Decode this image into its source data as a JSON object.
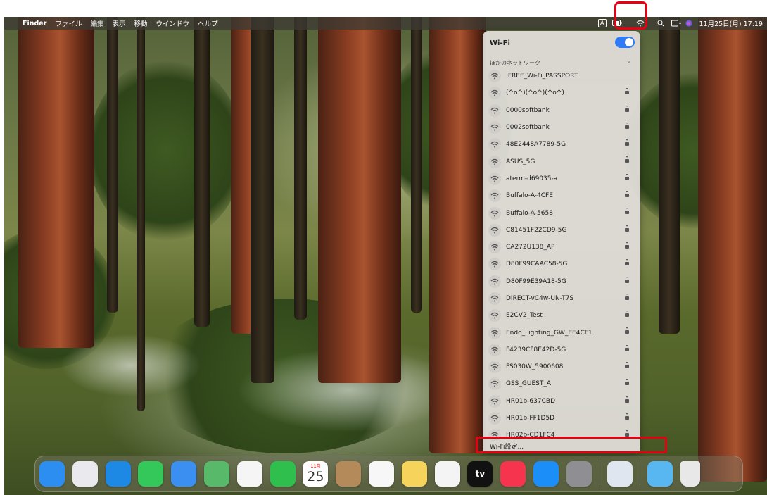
{
  "menubar": {
    "apple_glyph": "",
    "items": [
      "Finder",
      "ファイル",
      "編集",
      "表示",
      "移動",
      "ウインドウ",
      "ヘルプ"
    ],
    "input_indicator": "A",
    "clock": "11月25日(月) 17:19"
  },
  "wifi_menu": {
    "title": "Wi-Fi",
    "toggle_on": true,
    "other_networks_label": "ほかのネットワーク",
    "networks": [
      {
        "name": ".FREE_Wi-Fi_PASSPORT",
        "locked": false
      },
      {
        "name": "(^o^)(^o^)(^o^)",
        "locked": true
      },
      {
        "name": "0000softbank",
        "locked": true
      },
      {
        "name": "0002softbank",
        "locked": true
      },
      {
        "name": "48E2448A7789-5G",
        "locked": true
      },
      {
        "name": "ASUS_5G",
        "locked": true
      },
      {
        "name": "aterm-d69035-a",
        "locked": true
      },
      {
        "name": "Buffalo-A-4CFE",
        "locked": true
      },
      {
        "name": "Buffalo-A-5658",
        "locked": true
      },
      {
        "name": "C81451F22CD9-5G",
        "locked": true
      },
      {
        "name": "CA272U138_AP",
        "locked": true
      },
      {
        "name": "D80F99CAAC58-5G",
        "locked": true
      },
      {
        "name": "D80F99E39A18-5G",
        "locked": true
      },
      {
        "name": "DIRECT-vC4w-UN-T7S",
        "locked": true
      },
      {
        "name": "E2CV2_Test",
        "locked": true
      },
      {
        "name": "Endo_Lighting_GW_EE4CF1",
        "locked": true
      },
      {
        "name": "F4239CF8E42D-5G",
        "locked": true
      },
      {
        "name": "FS030W_5900608",
        "locked": true
      },
      {
        "name": "GSS_GUEST_A",
        "locked": true
      },
      {
        "name": "HR01b-637CBD",
        "locked": true
      },
      {
        "name": "HR01b-FF1D5D",
        "locked": true
      },
      {
        "name": "HR02b-CD1FC4",
        "locked": true
      }
    ],
    "settings_label": "Wi-Fi設定..."
  },
  "dock": {
    "calendar_month": "11月",
    "calendar_day": "25",
    "tv_label": "tv",
    "apps": [
      {
        "name": "finder",
        "color": "#2b8ef0"
      },
      {
        "name": "launchpad",
        "color": "#e9e9ee"
      },
      {
        "name": "safari",
        "color": "#1e88e5"
      },
      {
        "name": "messages",
        "color": "#34c759"
      },
      {
        "name": "mail",
        "color": "#3a8ff0"
      },
      {
        "name": "maps",
        "color": "#59b96a"
      },
      {
        "name": "photos",
        "color": "#f5f5f5"
      },
      {
        "name": "facetime",
        "color": "#2fbf4c"
      },
      {
        "name": "calendar",
        "color": "#ffffff"
      },
      {
        "name": "contacts",
        "color": "#b58a5a"
      },
      {
        "name": "reminders",
        "color": "#f7f7f7"
      },
      {
        "name": "notes",
        "color": "#f6d35b"
      },
      {
        "name": "freeform",
        "color": "#f4f4f4"
      },
      {
        "name": "apple-tv",
        "color": "#111111"
      },
      {
        "name": "music",
        "color": "#f7344e"
      },
      {
        "name": "app-store",
        "color": "#1b8ef7"
      },
      {
        "name": "system-settings",
        "color": "#8e8e93"
      },
      {
        "name": "preview",
        "color": "#dfe6ef"
      },
      {
        "name": "downloads-folder",
        "color": "#58b6f0"
      },
      {
        "name": "trash",
        "color": "#e8e8e8"
      }
    ]
  }
}
